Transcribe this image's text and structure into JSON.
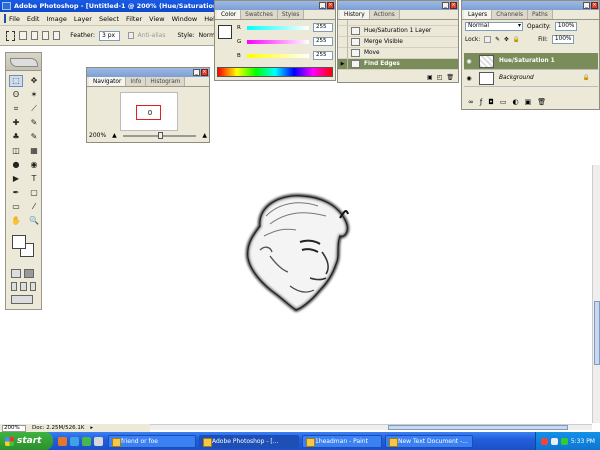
{
  "window": {
    "title": "Adobe Photoshop - [Untitled-1 @ 200% (Hue/Saturation"
  },
  "menu": [
    "File",
    "Edit",
    "Image",
    "Layer",
    "Select",
    "Filter",
    "View",
    "Window",
    "Help"
  ],
  "options": {
    "feather_label": "Feather:",
    "feather_value": "3 px",
    "antialias_label": "Anti-alias",
    "style_label": "Style:",
    "style_value": "Norm"
  },
  "toolbox": {
    "tools": [
      "marquee-icon",
      "move-icon",
      "lasso-icon",
      "magic-wand-icon",
      "crop-icon",
      "slice-icon",
      "healing-brush-icon",
      "brush-icon",
      "clone-stamp-icon",
      "history-brush-icon",
      "eraser-icon",
      "gradient-icon",
      "blur-icon",
      "dodge-icon",
      "path-select-icon",
      "type-icon",
      "pen-icon",
      "shape-icon",
      "notes-icon",
      "eyedropper-icon",
      "hand-icon",
      "zoom-icon"
    ],
    "glyphs": [
      "⬚",
      "✥",
      "ʘ",
      "✶",
      "⌗",
      "⟋",
      "✚",
      "✎",
      "♣",
      "✎",
      "◫",
      "▦",
      "●",
      "◉",
      "▶",
      "T",
      "✒",
      "▢",
      "▭",
      "⁄",
      "✋",
      "🔍"
    ]
  },
  "navigator": {
    "tabs": [
      "Navigator",
      "Info",
      "Histogram"
    ],
    "zoom": "200%"
  },
  "color": {
    "tabs": [
      "Color",
      "Swatches",
      "Styles"
    ],
    "channels": [
      {
        "label": "R",
        "value": "255"
      },
      {
        "label": "G",
        "value": "255"
      },
      {
        "label": "B",
        "value": "255"
      }
    ]
  },
  "history": {
    "tabs": [
      "History",
      "Actions"
    ],
    "items": [
      "Hue/Saturation 1 Layer",
      "Merge Visible",
      "Move",
      "Find Edges"
    ],
    "selected": "Find Edges"
  },
  "layers": {
    "tabs": [
      "Layers",
      "Channels",
      "Paths"
    ],
    "blend_mode": "Normal",
    "opacity_label": "Opacity:",
    "opacity_value": "100%",
    "lock_label": "Lock:",
    "fill_label": "Fill:",
    "fill_value": "100%",
    "items": [
      {
        "name": "Hue/Saturation 1",
        "selected": true
      },
      {
        "name": "Background",
        "selected": false
      }
    ]
  },
  "status": {
    "zoom": "200%",
    "doc": "Doc: 2.25M/526.1K"
  },
  "taskbar": {
    "start_label": "start",
    "tasks": [
      "friend or foe",
      "Adobe Photoshop - [...",
      "1headman - Paint",
      "New Text Document -..."
    ],
    "active_task": "Adobe Photoshop - [...",
    "clock": "5:33 PM"
  },
  "colors": {
    "selection": "#7a8c5a",
    "titlebar": "#0d48c9",
    "taskbar": "#245edb",
    "start": "#2d8f2d"
  }
}
